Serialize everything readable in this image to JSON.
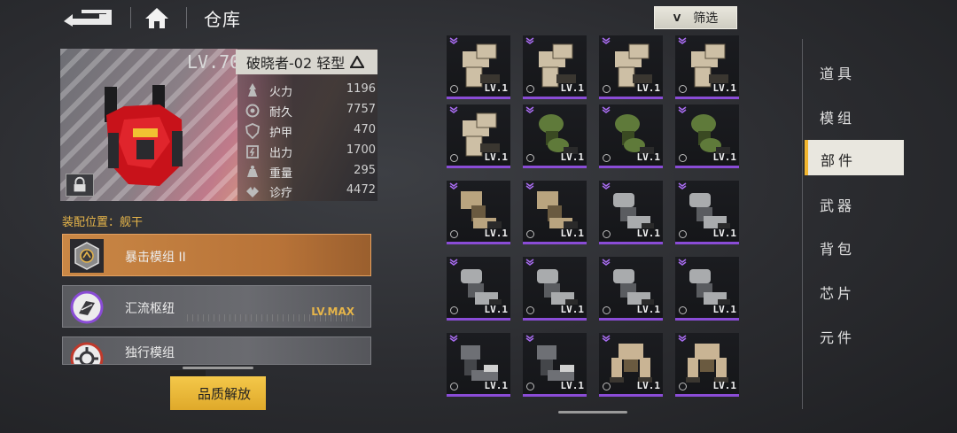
{
  "header": {
    "title": "仓库",
    "filter_label": "筛选"
  },
  "mech": {
    "level": "LV.70",
    "name": "破晓者-02 轻型",
    "stats": [
      {
        "name": "火力",
        "value": "1196",
        "icon": "firepower-icon"
      },
      {
        "name": "耐久",
        "value": "7757",
        "icon": "durability-icon"
      },
      {
        "name": "护甲",
        "value": "470",
        "icon": "armor-icon"
      },
      {
        "name": "出力",
        "value": "1700",
        "icon": "power-icon"
      },
      {
        "name": "重量",
        "value": "295",
        "icon": "weight-icon"
      },
      {
        "name": "诊疗",
        "value": "4472",
        "icon": "heal-icon"
      }
    ]
  },
  "install": {
    "label": "装配位置：舰干"
  },
  "modules": [
    {
      "name": "暴击模组 II",
      "level": ""
    },
    {
      "name": "汇流枢纽",
      "level": "LV.MAX"
    },
    {
      "name": "独行模组",
      "level": ""
    }
  ],
  "quality_button": "品质解放",
  "grid": {
    "level_label": "LV.1",
    "rows": [
      [
        "tan-arm",
        "tan-arm",
        "tan-arm",
        "tan-arm"
      ],
      [
        "tan-arm",
        "green-leg",
        "green-leg",
        "green-leg"
      ],
      [
        "tan-leg",
        "tan-leg",
        "grey-leg",
        "grey-leg"
      ],
      [
        "grey-leg",
        "grey-leg",
        "grey-leg",
        "grey-leg"
      ],
      [
        "dark-arm",
        "dark-arm",
        "tan-walker",
        "tan-walker"
      ]
    ],
    "colors": {
      "tan-arm": "#cdbfa5",
      "green-leg": "#5f7a3a",
      "tan-leg": "#b9a47f",
      "grey-leg": "#a9abad",
      "dark-arm": "#6e7075",
      "tan-walker": "#c9b494"
    }
  },
  "nav": {
    "items": [
      "道具",
      "模组",
      "部件",
      "武器",
      "背包",
      "芯片",
      "元件"
    ],
    "active_index": 2
  }
}
